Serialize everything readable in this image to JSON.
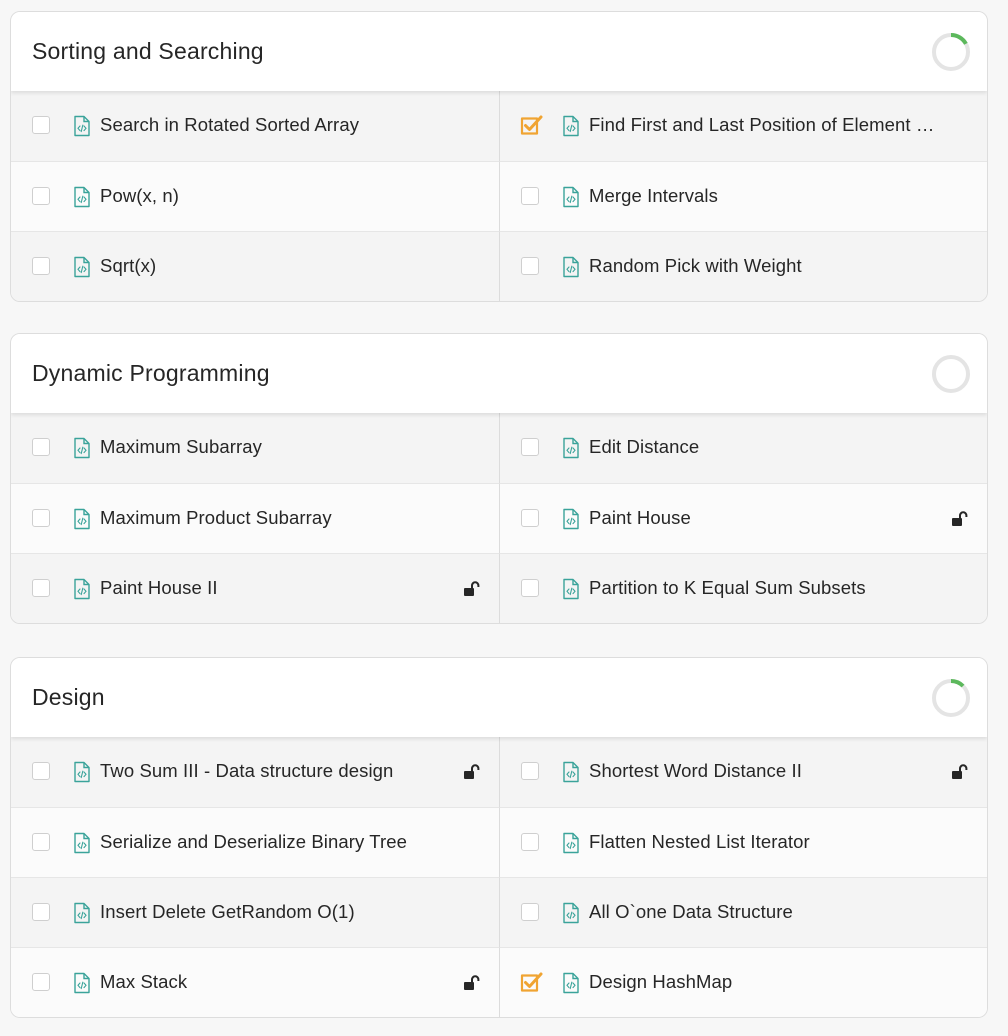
{
  "colors": {
    "checked": "#f0a432",
    "file_icon": "#3aa39a",
    "progress": "#5cb85c",
    "progress_track": "#e4e4e4",
    "lock": "#262626"
  },
  "sections": [
    {
      "title": "Sorting and Searching",
      "progress": 0.17,
      "rows": [
        [
          {
            "title": "Search in Rotated Sorted Array",
            "checked": false,
            "locked": false
          },
          {
            "title": "Find First and Last Position of Element in Sorted Array",
            "checked": true,
            "locked": false
          }
        ],
        [
          {
            "title": "Pow(x, n)",
            "checked": false,
            "locked": false
          },
          {
            "title": "Merge Intervals",
            "checked": false,
            "locked": false
          }
        ],
        [
          {
            "title": "Sqrt(x)",
            "checked": false,
            "locked": false
          },
          {
            "title": "Random Pick with Weight",
            "checked": false,
            "locked": false
          }
        ]
      ]
    },
    {
      "title": "Dynamic Programming",
      "progress": 0,
      "rows": [
        [
          {
            "title": "Maximum Subarray",
            "checked": false,
            "locked": false
          },
          {
            "title": "Edit Distance",
            "checked": false,
            "locked": false
          }
        ],
        [
          {
            "title": "Maximum Product Subarray",
            "checked": false,
            "locked": false
          },
          {
            "title": "Paint House",
            "checked": false,
            "locked": true
          }
        ],
        [
          {
            "title": "Paint House II",
            "checked": false,
            "locked": true
          },
          {
            "title": "Partition to K Equal Sum Subsets",
            "checked": false,
            "locked": false
          }
        ]
      ]
    },
    {
      "title": "Design",
      "progress": 0.125,
      "rows": [
        [
          {
            "title": "Two Sum III - Data structure design",
            "checked": false,
            "locked": true
          },
          {
            "title": "Shortest Word Distance II",
            "checked": false,
            "locked": true
          }
        ],
        [
          {
            "title": "Serialize and Deserialize Binary Tree",
            "checked": false,
            "locked": false
          },
          {
            "title": "Flatten Nested List Iterator",
            "checked": false,
            "locked": false
          }
        ],
        [
          {
            "title": "Insert Delete GetRandom O(1)",
            "checked": false,
            "locked": false
          },
          {
            "title": "All O`one Data Structure",
            "checked": false,
            "locked": false
          }
        ],
        [
          {
            "title": "Max Stack",
            "checked": false,
            "locked": true
          },
          {
            "title": "Design HashMap",
            "checked": true,
            "locked": false
          }
        ]
      ]
    }
  ]
}
